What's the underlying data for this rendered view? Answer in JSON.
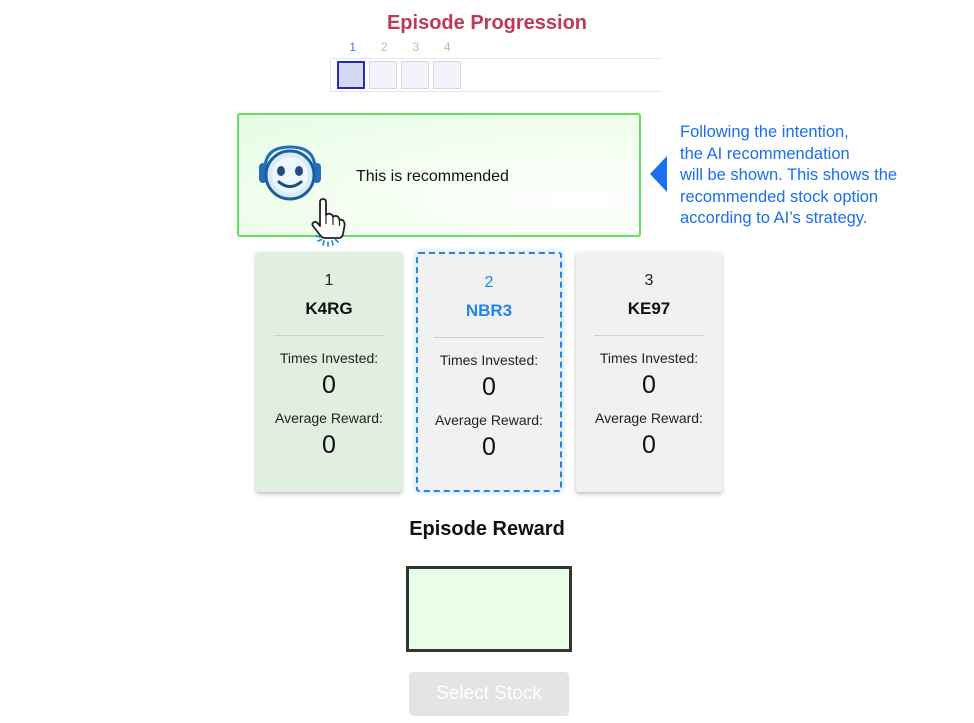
{
  "header": {
    "title": "Episode Progression"
  },
  "progression": {
    "steps": [
      "1",
      "2",
      "3",
      "4"
    ],
    "active_step": 1
  },
  "recommendation": {
    "text": "This is recommended",
    "icons": [
      "robot-icon",
      "pointing-hand-icon"
    ]
  },
  "callout": {
    "text": "Following the intention,\nthe AI recommendation\nwill be shown. This shows the\nrecommended stock option\naccording to AI’s strategy."
  },
  "stocks": [
    {
      "number": "1",
      "code": "K4RG",
      "times_label": "Times Invested:",
      "times_value": "0",
      "reward_label": "Average Reward:",
      "reward_value": "0"
    },
    {
      "number": "2",
      "code": "NBR3",
      "times_label": "Times Invested:",
      "times_value": "0",
      "reward_label": "Average Reward:",
      "reward_value": "0"
    },
    {
      "number": "3",
      "code": "KE97",
      "times_label": "Times Invested:",
      "times_value": "0",
      "reward_label": "Average Reward:",
      "reward_value": "0"
    }
  ],
  "episode_reward": {
    "title": "Episode Reward"
  },
  "actions": {
    "select_label": "Select Stock"
  },
  "colors": {
    "title": "#c0395a",
    "accent_blue": "#1a6ef0",
    "recommended_card": "#e0efe0",
    "selected_border": "#2583ee",
    "reward_box": "#eaffea"
  }
}
